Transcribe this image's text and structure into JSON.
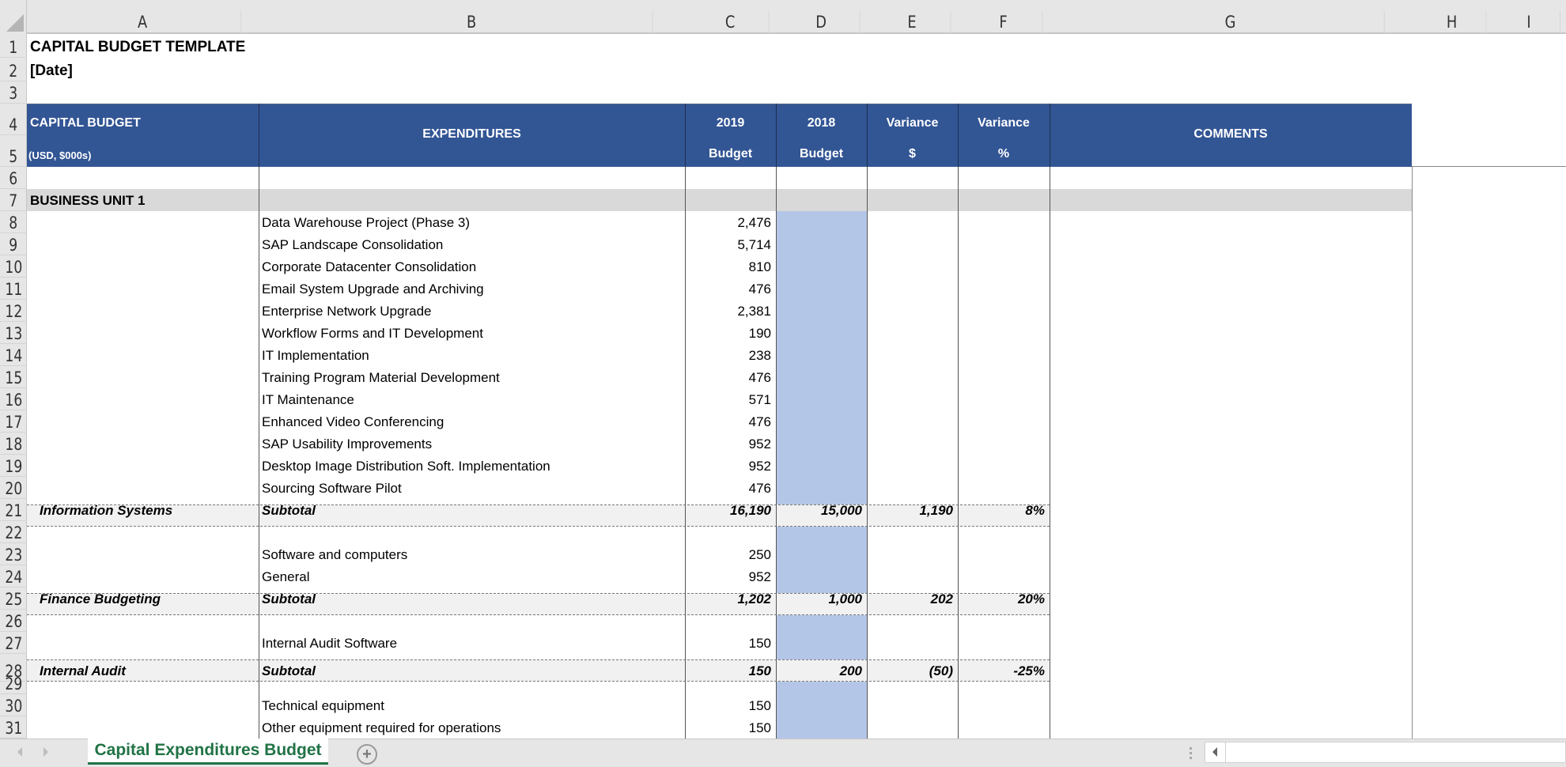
{
  "columns": [
    "A",
    "B",
    "C",
    "D",
    "E",
    "F",
    "G",
    "H",
    "I"
  ],
  "rows": [
    "1",
    "2",
    "3",
    "4",
    "5",
    "6",
    "7",
    "8",
    "9",
    "10",
    "11",
    "12",
    "13",
    "14",
    "15",
    "16",
    "17",
    "18",
    "19",
    "20",
    "21",
    "22",
    "23",
    "24",
    "25",
    "26",
    "27",
    "28",
    "29",
    "30",
    "31"
  ],
  "title": "CAPITAL BUDGET TEMPLATE",
  "date": "[Date]",
  "header": {
    "col_a_line1": "CAPITAL BUDGET",
    "col_a_line2": "(USD, $000s)",
    "col_b": "EXPENDITURES",
    "col_c_line1": "2019",
    "col_c_line2": "Budget",
    "col_d_line1": "2018",
    "col_d_line2": "Budget",
    "col_e_line1": "Variance",
    "col_e_line2": "$",
    "col_f_line1": "Variance",
    "col_f_line2": "%",
    "col_g": "COMMENTS"
  },
  "section": "BUSINESS UNIT 1",
  "items": [
    {
      "name": "Data Warehouse Project (Phase 3)",
      "budget_2019": "2,476"
    },
    {
      "name": "SAP Landscape Consolidation",
      "budget_2019": "5,714"
    },
    {
      "name": "Corporate Datacenter Consolidation",
      "budget_2019": "810"
    },
    {
      "name": "Email System Upgrade and Archiving",
      "budget_2019": "476"
    },
    {
      "name": "Enterprise Network Upgrade",
      "budget_2019": "2,381"
    },
    {
      "name": "Workflow Forms and IT Development",
      "budget_2019": "190"
    },
    {
      "name": "IT Implementation",
      "budget_2019": "238"
    },
    {
      "name": "Training Program Material Development",
      "budget_2019": "476"
    },
    {
      "name": "IT Maintenance",
      "budget_2019": "571"
    },
    {
      "name": "Enhanced Video Conferencing",
      "budget_2019": "476"
    },
    {
      "name": "SAP Usability Improvements",
      "budget_2019": "952"
    },
    {
      "name": "Desktop Image Distribution Soft. Implementation",
      "budget_2019": "952"
    },
    {
      "name": "Sourcing Software Pilot",
      "budget_2019": "476"
    },
    {
      "name": "Software and computers",
      "budget_2019": "250"
    },
    {
      "name": "General",
      "budget_2019": "952"
    },
    {
      "name": "Internal Audit Software",
      "budget_2019": "150"
    },
    {
      "name": "Technical equipment",
      "budget_2019": "150"
    },
    {
      "name": "Other equipment required for operations",
      "budget_2019": "150"
    }
  ],
  "subtotals": [
    {
      "group": "Information Systems",
      "label": "Subtotal",
      "budget_2019": "16,190",
      "budget_2018": "15,000",
      "variance_usd": "1,190",
      "variance_pct": "8%"
    },
    {
      "group": "Finance Budgeting",
      "label": "Subtotal",
      "budget_2019": "1,202",
      "budget_2018": "1,000",
      "variance_usd": "202",
      "variance_pct": "20%"
    },
    {
      "group": "Internal Audit",
      "label": "Subtotal",
      "budget_2019": "150",
      "budget_2018": "200",
      "variance_usd": "(50)",
      "variance_pct": "-25%"
    }
  ],
  "tabs": {
    "active_sheet": "Capital Expenditures Budget",
    "add_sheet": "+"
  },
  "colors": {
    "header_fill": "#325594",
    "input_fill": "#b4c6e7",
    "section_fill": "#d9d9d9",
    "subtotal_fill": "#f1f1f1",
    "tab_accent": "#217346"
  }
}
